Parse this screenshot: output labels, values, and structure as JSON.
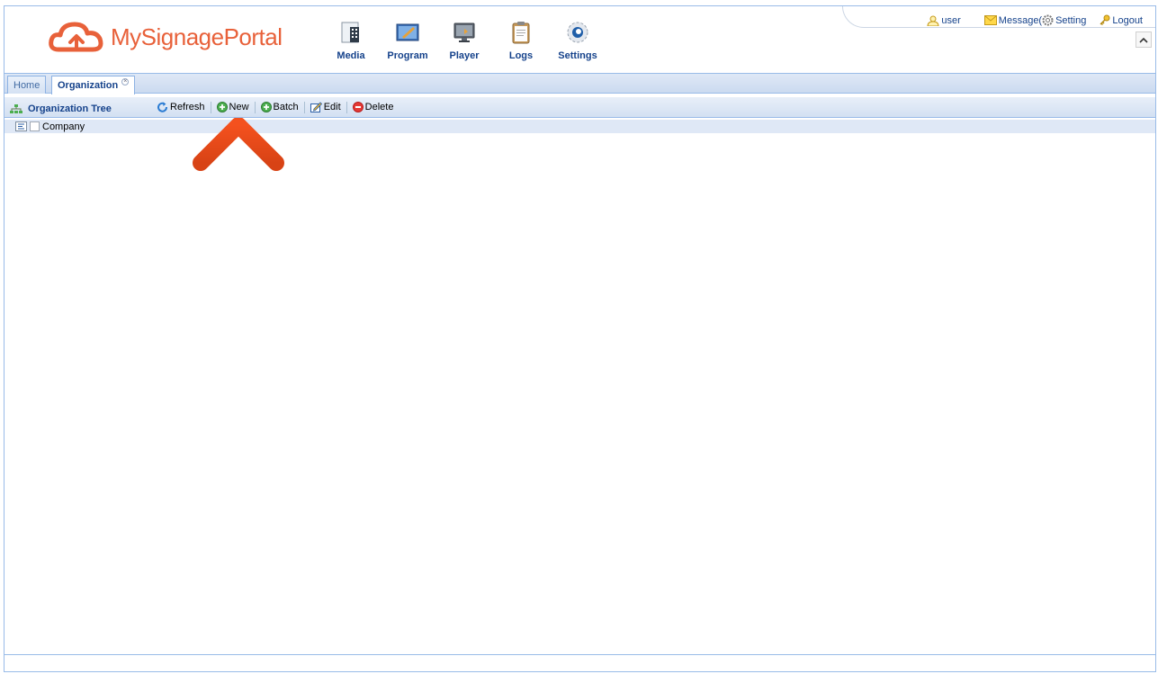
{
  "brand": {
    "part1": "My",
    "part2": "Signage",
    "part3": "Portal"
  },
  "nav": [
    {
      "label": "Media",
      "icon": "media-icon"
    },
    {
      "label": "Program",
      "icon": "program-icon"
    },
    {
      "label": "Player",
      "icon": "player-icon"
    },
    {
      "label": "Logs",
      "icon": "logs-icon"
    },
    {
      "label": "Settings",
      "icon": "settings-icon"
    }
  ],
  "top_links": {
    "user": "user",
    "message": "Message(",
    "setting": "Setting",
    "logout": "Logout"
  },
  "tabs": {
    "home": "Home",
    "organization": "Organization"
  },
  "toolbar": {
    "tree_title": "Organization Tree",
    "refresh": "Refresh",
    "new": "New",
    "batch": "Batch",
    "edit": "Edit",
    "delete": "Delete"
  },
  "tree": {
    "root": "Company"
  },
  "colors": {
    "brand_orange": "#e8613a",
    "nav_text": "#15428b",
    "border": "#99bbe8",
    "arrow": "#e8511e"
  }
}
